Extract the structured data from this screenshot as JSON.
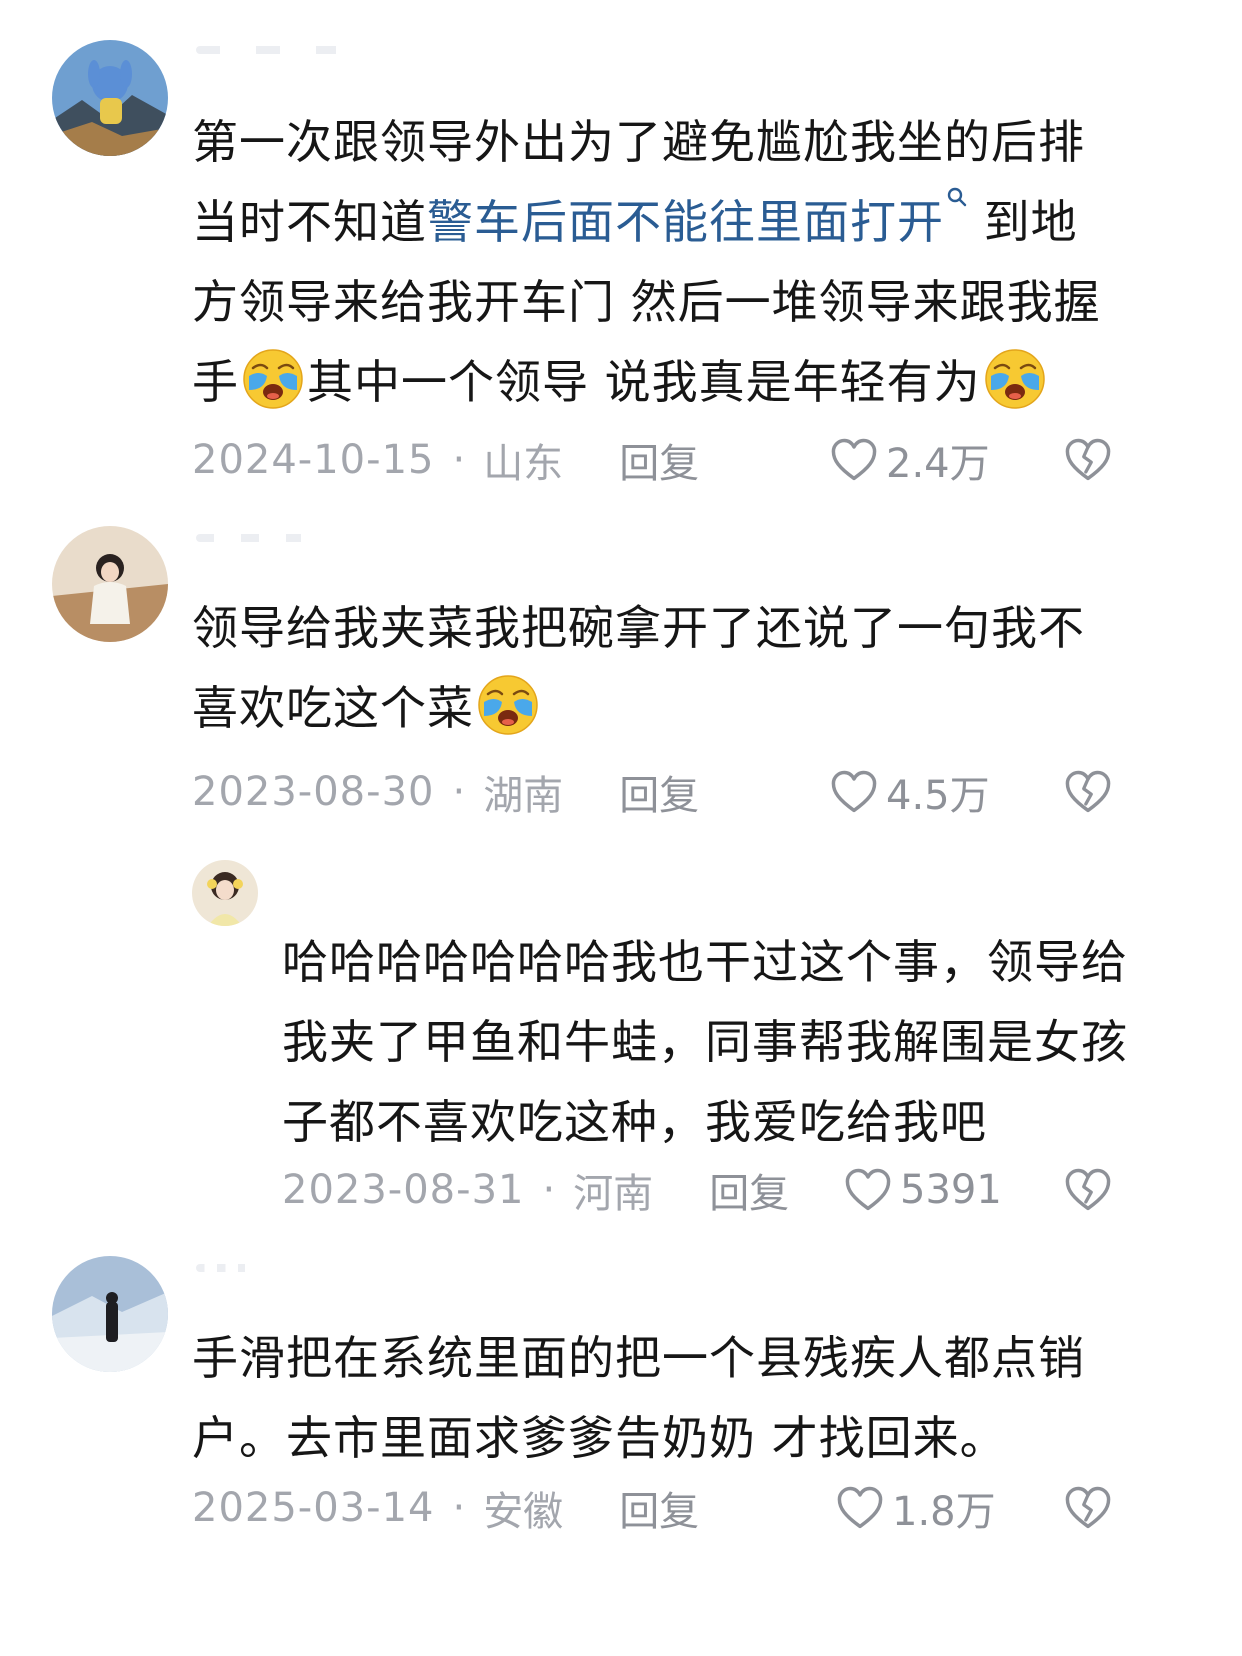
{
  "comments": [
    {
      "text_before": "第一次跟领导外出为了避免尴尬我坐的后排当时不知道",
      "link": "警车后面不能往里面打开",
      "text_after": " 到地方领导来给我开车门  然后一堆领导来跟我握手",
      "text_mid": "其中一个领导  说我真是年轻有为",
      "date": "2024-10-15",
      "location": "山东",
      "reply": "回复",
      "likes": "2.4万"
    },
    {
      "text": "领导给我夹菜我把碗拿开了还说了一句我不喜欢吃这个菜",
      "date": "2023-08-30",
      "location": "湖南",
      "reply": "回复",
      "likes": "4.5万"
    },
    {
      "text": "哈哈哈哈哈哈哈我也干过这个事，领导给我夹了甲鱼和牛蛙，同事帮我解围是女孩子都不喜欢吃这种，我爱吃给我吧",
      "date": "2023-08-31",
      "location": "河南",
      "reply": "回复",
      "likes": "5391"
    },
    {
      "text": "手滑把在系统里面的把一个县残疾人都点销户。去市里面求爹爹告奶奶 才找回来。",
      "date": "2025-03-14",
      "location": "安徽",
      "reply": "回复",
      "likes": "1.8万"
    }
  ],
  "separator": "·",
  "colors": {
    "link": "#2a5c93",
    "meta": "#a3a6ad",
    "text": "#161616"
  }
}
